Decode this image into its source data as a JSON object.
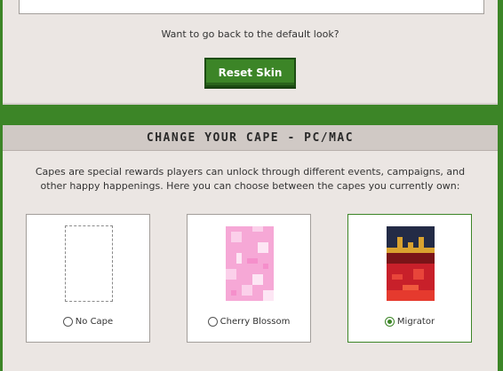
{
  "reset": {
    "question": "Want to go back to the default look?",
    "button_label": "Reset Skin"
  },
  "cape": {
    "heading": "CHANGE YOUR CAPE - PC/MAC",
    "description": "Capes are special rewards players can unlock through different events, campaigns, and other happy happenings. Here you can choose between the capes you currently own:",
    "options": [
      {
        "label": "No Cape",
        "selected": false
      },
      {
        "label": "Cherry Blossom",
        "selected": false
      },
      {
        "label": "Migrator",
        "selected": true
      }
    ]
  },
  "colors": {
    "accent": "#3c8527",
    "panel": "#ebe6e3",
    "header": "#d0c9c5"
  }
}
